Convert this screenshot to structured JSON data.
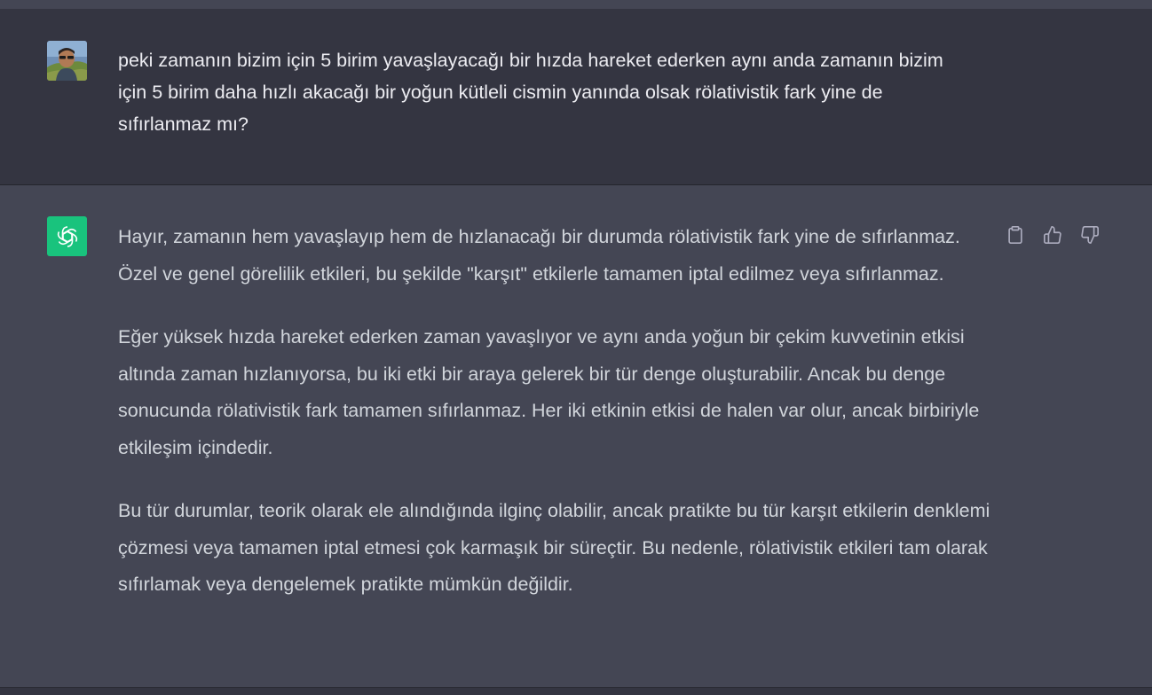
{
  "conversation": {
    "user_message": {
      "avatar_icon": "user-photo-avatar",
      "text": "peki zamanın bizim için 5 birim yavaşlayacağı bir hızda hareket ederken aynı anda zamanın bizim için 5 birim daha hızlı akacağı bir yoğun kütleli cismin yanında olsak rölativistik fark yine de sıfırlanmaz mı?"
    },
    "assistant_message": {
      "avatar_icon": "openai-logo-icon",
      "paragraphs": [
        "Hayır, zamanın hem yavaşlayıp hem de hızlanacağı bir durumda rölativistik fark yine de sıfırlanmaz. Özel ve genel görelilik etkileri, bu şekilde \"karşıt\" etkilerle tamamen iptal edilmez veya sıfırlanmaz.",
        "Eğer yüksek hızda hareket ederken zaman yavaşlıyor ve aynı anda yoğun bir çekim kuvvetinin etkisi altında zaman hızlanıyorsa, bu iki etki bir araya gelerek bir tür denge oluşturabilir. Ancak bu denge sonucunda rölativistik fark tamamen sıfırlanmaz. Her iki etkinin etkisi de halen var olur, ancak birbiriyle etkileşim içindedir.",
        "Bu tür durumlar, teorik olarak ele alındığında ilginç olabilir, ancak pratikte bu tür karşıt etkilerin denklemi çözmesi veya tamamen iptal etmesi çok karmaşık bir süreçtir. Bu nedenle, rölativistik etkileri tam olarak sıfırlamak veya dengelemek pratikte mümkün değildir."
      ],
      "actions": [
        "clipboard-icon",
        "thumbs-up-icon",
        "thumbs-down-icon"
      ]
    }
  },
  "colors": {
    "user_bg": "#343541",
    "assistant_bg": "#444654",
    "user_text": "#ececf1",
    "assistant_text": "#d1d5db",
    "brand_green": "#19c37d",
    "icon_gray": "#acacbe"
  }
}
